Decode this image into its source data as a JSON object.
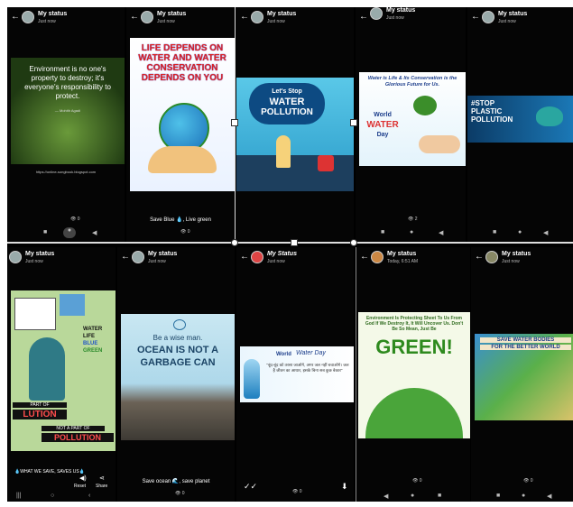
{
  "header": {
    "title": "My status",
    "subtitle": "Just now",
    "alt_title": "My Status",
    "alt_subtitle": "Today, 6:51 AM"
  },
  "panels": {
    "p1": {
      "quote": "Environment is no one's property to destroy; it's everyone's responsibility to protect.",
      "author": "— Mohith Agadi",
      "link": "https://online-songbook.blogspot.com",
      "views": "0"
    },
    "p2": {
      "poster_title": "LIFE DEPENDS ON WATER AND WATER CONSERVATION DEPENDS ON YOU",
      "caption": "Save Blue 💧, Live green",
      "views": "0"
    },
    "p3": {
      "line1": "Let's Stop",
      "line2": "WATER",
      "line3": "POLLUTION"
    },
    "p4": {
      "quote": "Water is Life & Its Conservation is the Glorious Future for Us.",
      "label1": "World",
      "label2": "WATER",
      "label3": "Day",
      "views": "2"
    },
    "p5": {
      "line1": "#STOP",
      "line2": "PLASTIC",
      "line3": "POLLUTION"
    },
    "p6": {
      "part1": "PART OF",
      "part2": "LUTION",
      "part3": "NOT A PART OF",
      "part4": "POLLUTION",
      "side1": "WATER",
      "side2": "LIFE",
      "side3": "BLUE",
      "side4": "GREEN",
      "caption": "💧WHAT WE SAVE, SAVES US💧",
      "reset": "Reset",
      "share": "Share"
    },
    "p7": {
      "line1": "Be a wise man.",
      "line2": "OCEAN IS NOT A",
      "line3": "GARBAGE CAN",
      "caption": "Save ocean 🌊, save planet",
      "views": "0"
    },
    "p8": {
      "label1": "World",
      "label2": "Water Day",
      "hindi": "\"बूंद-बूंद को तरसा जाओगे, अगर जल नहीं बचाओगे। जल है जीवन का आधार, इसके बिना सब कुछ बेकार\"",
      "views": "0"
    },
    "p9": {
      "top": "Environment Is Protecting Sheet To Us From God If We Destroy It, It Will Uncover Us. Don't Be So Mean, Just Be",
      "big": "GREEN!",
      "views": "0"
    },
    "p10": {
      "line1": "SAVE WATER BODIES",
      "line2": "FOR THE BETTER WORLD",
      "views": "0"
    }
  }
}
